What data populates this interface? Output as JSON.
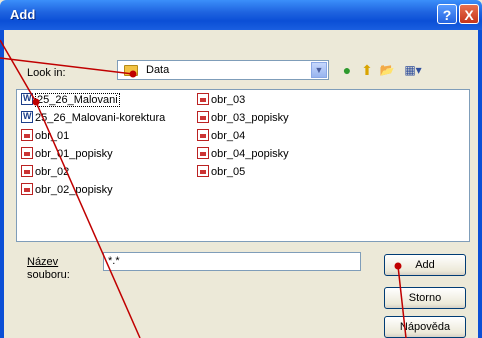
{
  "window": {
    "title": "Add",
    "help_glyph": "?",
    "close_glyph": "X"
  },
  "lookin": {
    "label": "Look in:",
    "value": "Data",
    "arrow": "▼"
  },
  "toolbar": {
    "back_glyph": "●",
    "up_glyph": "⬆",
    "newfolder_glyph": "📂",
    "view_glyph": "▦▾"
  },
  "files": [
    {
      "name": "25_26_Malovani",
      "type": "word"
    },
    {
      "name": "25_26_Malovani-korektura",
      "type": "word"
    },
    {
      "name": "obr_01",
      "type": "image"
    },
    {
      "name": "obr_01_popisky",
      "type": "image"
    },
    {
      "name": "obr_02",
      "type": "image"
    },
    {
      "name": "obr_02_popisky",
      "type": "image"
    },
    {
      "name": "obr_03",
      "type": "image"
    },
    {
      "name": "obr_03_popisky",
      "type": "image"
    },
    {
      "name": "obr_04",
      "type": "image"
    },
    {
      "name": "obr_04_popisky",
      "type": "image"
    },
    {
      "name": "obr_05",
      "type": "image"
    }
  ],
  "filename": {
    "label_line1": "Název",
    "label_line2": "souboru:",
    "value": "*.*"
  },
  "buttons": {
    "add": "Add",
    "cancel": "Storno",
    "help": "Nápověda"
  },
  "colors": {
    "titlebar": "#0b4fd6",
    "callout": "#c00000",
    "dialog_bg": "#ece9d8"
  }
}
